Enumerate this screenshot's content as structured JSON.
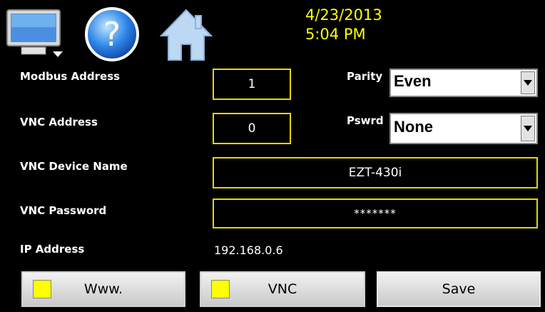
{
  "header": {
    "icons": [
      "monitor-icon",
      "help-icon",
      "home-icon"
    ],
    "date": "4/23/2013",
    "time": "5:04 PM",
    "date_color": "#ffff00"
  },
  "form": {
    "modbus_address_label": "Modbus Address",
    "modbus_address_value": "1",
    "parity_label": "Parity",
    "parity_value": "Even",
    "vnc_address_label": "VNC Address",
    "vnc_address_value": "0",
    "pswrd_label": "Pswrd",
    "pswrd_value": "None",
    "vnc_device_name_label": "VNC Device Name",
    "vnc_device_name_value": "EZT-430i",
    "vnc_password_label": "VNC Password",
    "vnc_password_value": "*******",
    "ip_address_label": "IP Address",
    "ip_address_value": "192.168.0.6"
  },
  "buttons": {
    "www_label": "Www.",
    "vnc_label": "VNC",
    "save_label": "Save"
  },
  "colors": {
    "field_border": "#e8d700",
    "indicator": "#ffff00"
  }
}
